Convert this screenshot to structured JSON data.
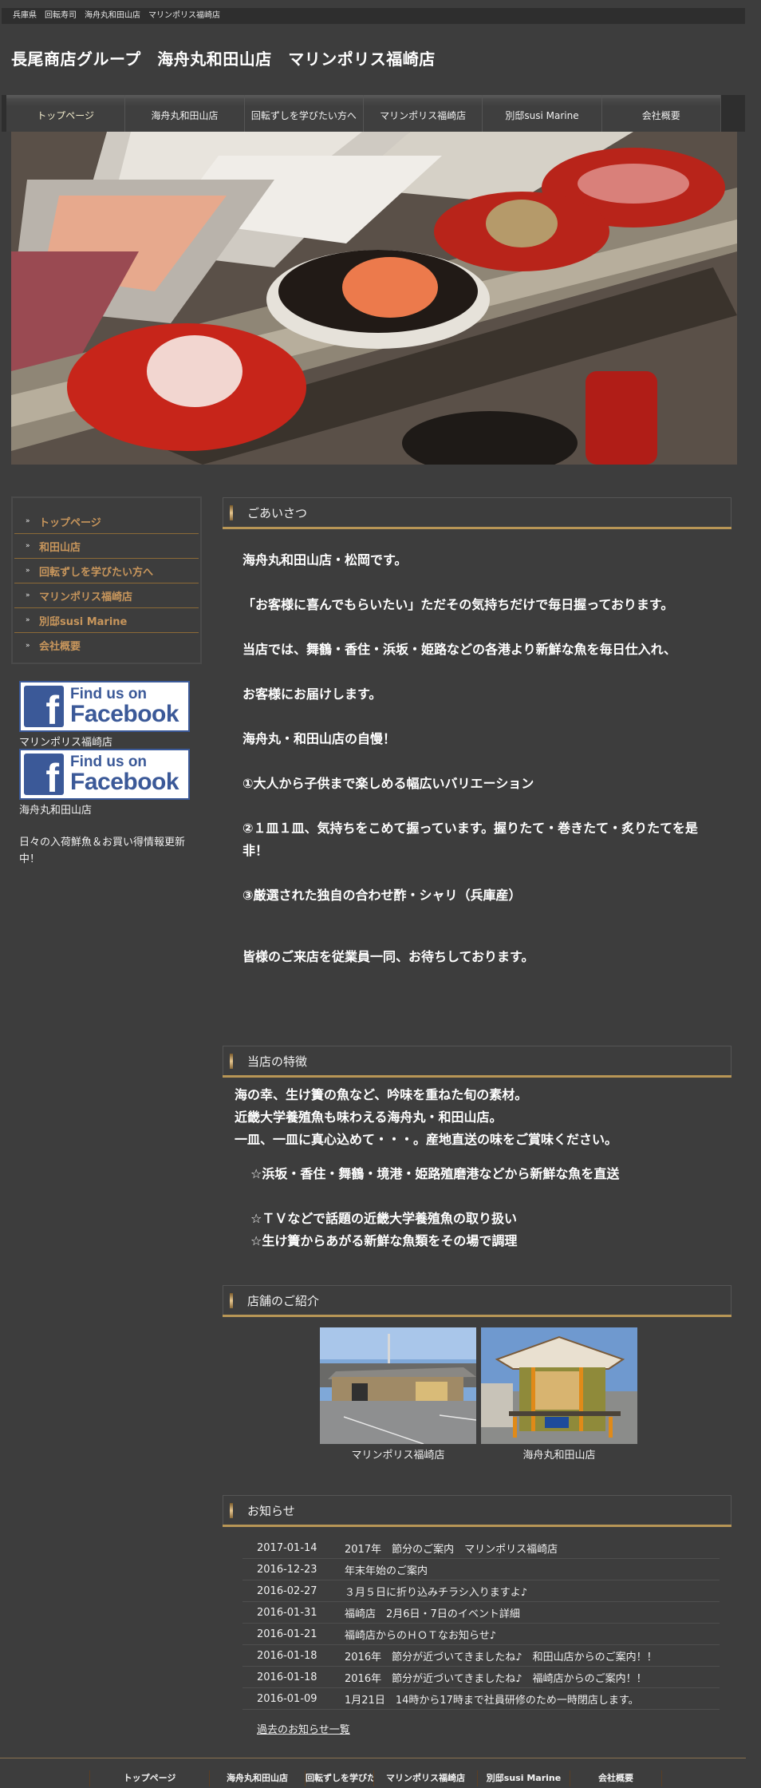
{
  "header": {
    "breadcrumb_keywords": "兵庫県　回転寿司　海舟丸和田山店　マリンポリス福崎店",
    "site_title": "長尾商店グループ　海舟丸和田山店　マリンポリス福崎店"
  },
  "global_nav": {
    "items": [
      {
        "label": "トップページ",
        "active": true
      },
      {
        "label": "海舟丸和田山店"
      },
      {
        "label": "回転ずしを学びたい方へ"
      },
      {
        "label": "マリンポリス福崎店"
      },
      {
        "label": "別邸susi Marine"
      },
      {
        "label": "会社概要"
      }
    ]
  },
  "hero": {
    "image_alt": "conveyor-belt-sushi-plates-photo"
  },
  "sidebar": {
    "nav_bullet": "»",
    "nav": [
      {
        "label": "トップページ"
      },
      {
        "label": "和田山店"
      },
      {
        "label": "回転ずしを学びたい方へ"
      },
      {
        "label": "マリンポリス福崎店"
      },
      {
        "label": "別邸susi Marine"
      },
      {
        "label": "会社概要"
      }
    ],
    "facebook": [
      {
        "line1": "Find us on",
        "line2": "Facebook",
        "caption": "マリンポリス福崎店"
      },
      {
        "line1": "Find us on",
        "line2": "Facebook",
        "caption": "海舟丸和田山店"
      }
    ],
    "note": "日々の入荷鮮魚＆お買い得情報更新中！"
  },
  "sections": {
    "greeting": {
      "title": "ごあいさつ",
      "paragraphs": [
        "海舟丸和田山店・松岡です。",
        "「お客様に喜んでもらいたい」ただその気持ちだけで毎日握っております。",
        "当店では、舞鶴・香住・浜坂・姫路などの各港より新鮮な魚を毎日仕入れ、",
        "お客様にお届けします。",
        "海舟丸・和田山店の自慢！",
        "①大人から子供まで楽しめる幅広いバリエーション",
        "②１皿１皿、気持ちをこめて握っています。握りたて・巻きたて・炙りたてを是非！",
        "③厳選された独自の合わせ酢・シャリ（兵庫産）",
        "皆様のご来店を従業員一同、お待ちしております。"
      ]
    },
    "features": {
      "title": "当店の特徴",
      "intro": [
        "海の幸、生け簀の魚など、吟味を重ねた旬の素材。",
        "近畿大学養殖魚も味わえる海舟丸・和田山店。",
        "一皿、一皿に真心込めて・・・。産地直送の味をご賞味ください。"
      ],
      "points": [
        "☆浜坂・香住・舞鶴・境港・姫路殖磨港などから新鮮な魚を直送",
        "☆ＴＶなどで話題の近畿大学養殖魚の取り扱い",
        "☆生け簀からあがる新鮮な魚類をその場で調理"
      ]
    },
    "stores": {
      "title": "店舗のご紹介",
      "items": [
        {
          "caption": "マリンポリス福崎店"
        },
        {
          "caption": "海舟丸和田山店"
        }
      ]
    },
    "news": {
      "title": "お知らせ",
      "items": [
        {
          "date": "2017-01-14",
          "text": "2017年　節分のご案内　マリンポリス福崎店"
        },
        {
          "date": "2016-12-23",
          "text": "年末年始のご案内"
        },
        {
          "date": "2016-02-27",
          "text": " ３月５日に折り込みチラシ入りますよ♪"
        },
        {
          "date": "2016-01-31",
          "text": "福崎店　2月6日・7日のイベント詳細"
        },
        {
          "date": "2016-01-21",
          "text": "福崎店からのＨＯＴなお知らせ♪"
        },
        {
          "date": "2016-01-18",
          "text": "2016年　節分が近づいてきましたね♪　和田山店からのご案内！！"
        },
        {
          "date": "2016-01-18",
          "text": "2016年　節分が近づいてきましたね♪　福崎店からのご案内！！"
        },
        {
          "date": "2016-01-09",
          "text": "1月21日　14時から17時まで社員研修のため一時閉店します。"
        }
      ],
      "more_link": "過去のお知らせ一覧"
    }
  },
  "footer_nav": {
    "items": [
      {
        "label": "トップページ"
      },
      {
        "label": "海舟丸和田山店"
      },
      {
        "label": "回転ずしを学びたい方へ"
      },
      {
        "label": "マリンポリス福崎店"
      },
      {
        "label": "別邸susi Marine"
      },
      {
        "label": "会社概要"
      }
    ]
  },
  "colors": {
    "background": "#3d3d3d",
    "accent_gold": "#b89656",
    "sidebar_link": "#c8965c",
    "facebook_blue": "#3b5998"
  }
}
